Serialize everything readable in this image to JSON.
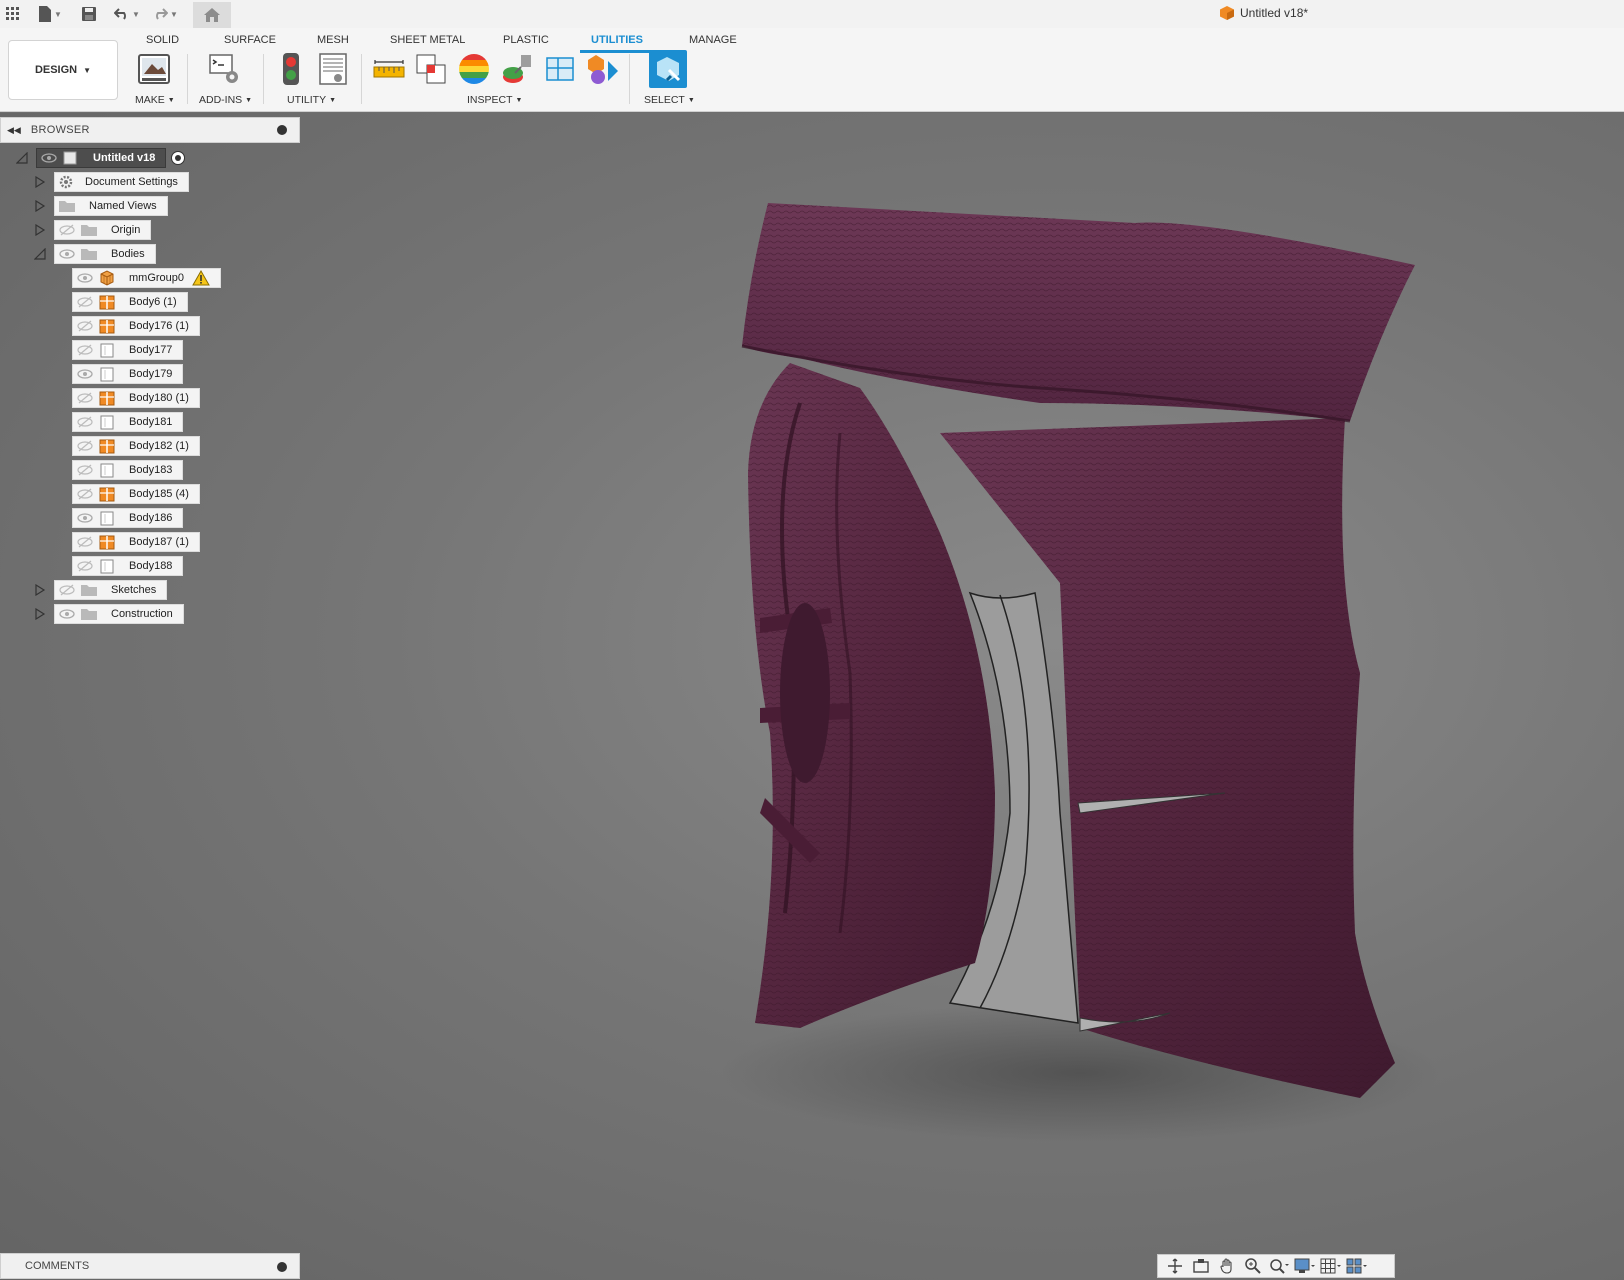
{
  "app": {
    "document_title": "Untitled v18*"
  },
  "toolbar": {
    "workspace": "DESIGN",
    "tabs": [
      "SOLID",
      "SURFACE",
      "MESH",
      "SHEET METAL",
      "PLASTIC",
      "UTILITIES",
      "MANAGE"
    ],
    "active_tab": "UTILITIES",
    "groups": {
      "make": "MAKE",
      "addins": "ADD-INS",
      "utility": "UTILITY",
      "inspect": "INSPECT",
      "select": "SELECT"
    },
    "accent_color": "#1b8ed1"
  },
  "browser": {
    "title": "BROWSER",
    "root": "Untitled v18",
    "items": [
      {
        "label": "Document Settings",
        "icon": "gear-icon"
      },
      {
        "label": "Named Views",
        "icon": "folder-icon"
      },
      {
        "label": "Origin",
        "icon": "folder-icon"
      },
      {
        "label": "Bodies",
        "icon": "folder-icon"
      }
    ],
    "bodies": [
      {
        "label": "mmGroup0",
        "icon": "mesh-group-icon",
        "warning": true
      },
      {
        "label": "Body6 (1)",
        "icon": "body-orange-icon"
      },
      {
        "label": "Body176 (1)",
        "icon": "body-orange-icon"
      },
      {
        "label": "Body177",
        "icon": "body-white-icon"
      },
      {
        "label": "Body179",
        "icon": "body-white-icon"
      },
      {
        "label": "Body180 (1)",
        "icon": "body-orange-icon"
      },
      {
        "label": "Body181",
        "icon": "body-white-icon"
      },
      {
        "label": "Body182 (1)",
        "icon": "body-orange-icon"
      },
      {
        "label": "Body183",
        "icon": "body-white-icon"
      },
      {
        "label": "Body185 (4)",
        "icon": "body-orange-icon"
      },
      {
        "label": "Body186",
        "icon": "body-white-icon"
      },
      {
        "label": "Body187 (1)",
        "icon": "body-orange-icon"
      },
      {
        "label": "Body188",
        "icon": "body-white-icon"
      }
    ],
    "after": [
      {
        "label": "Sketches",
        "icon": "folder-icon"
      },
      {
        "label": "Construction",
        "icon": "folder-icon"
      }
    ]
  },
  "comments": {
    "title": "COMMENTS"
  },
  "model": {
    "mesh_color": "#5a2a45",
    "part_color": "#9a9a9a"
  }
}
